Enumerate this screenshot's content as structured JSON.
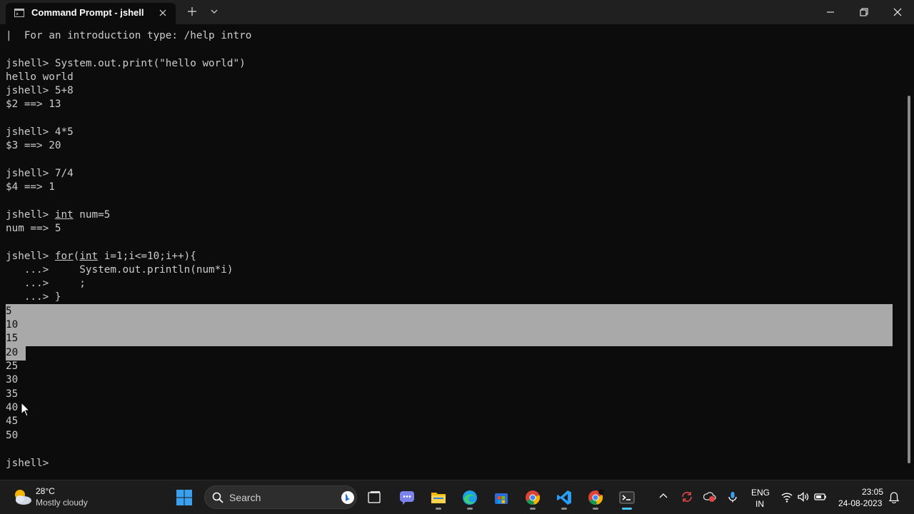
{
  "window": {
    "tab_title": "Command Prompt - jshell",
    "icons": {
      "tab": "terminal-icon",
      "close_tab": "close-icon",
      "new_tab": "plus-icon",
      "dropdown": "chevron-down-icon",
      "minimize": "minimize-icon",
      "maximize": "restore-icon",
      "close": "close-icon"
    }
  },
  "terminal": {
    "lines": [
      "|  For an introduction type: /help intro",
      "",
      "jshell> System.out.print(\"hello world\")",
      "hello world",
      "jshell> 5+8",
      "$2 ==> 13",
      "",
      "jshell> 4*5",
      "$3 ==> 20",
      "",
      "jshell> 7/4",
      "$4 ==> 1",
      "",
      "jshell> int num=5",
      "num ==> 5",
      "",
      "jshell> for(int i=1;i<=10;i++){",
      "   ...>     System.out.println(num*i)",
      "   ...>     ;",
      "   ...> }",
      "5",
      "10",
      "15",
      "20",
      "25",
      "30",
      "35",
      "40",
      "45",
      "50",
      "",
      "jshell>"
    ],
    "selected_lines": [
      "5",
      "10",
      "15",
      "20"
    ],
    "underlined_keywords": [
      "int",
      "for"
    ],
    "colors": {
      "background": "#0c0c0c",
      "foreground": "#cccccc",
      "selection": "#a9a9a9"
    }
  },
  "taskbar": {
    "weather": {
      "temperature": "28°C",
      "condition": "Mostly cloudy",
      "icon": "partly-cloudy-icon"
    },
    "search": {
      "placeholder": "Search"
    },
    "apps": [
      {
        "name": "windows-start",
        "icon": "windows-logo-icon"
      },
      {
        "name": "task-view",
        "icon": "task-view-icon"
      },
      {
        "name": "teams",
        "icon": "teams-chat-icon"
      },
      {
        "name": "file-explorer",
        "icon": "folder-icon",
        "running": true
      },
      {
        "name": "edge",
        "icon": "edge-icon",
        "running": true
      },
      {
        "name": "store",
        "icon": "store-icon"
      },
      {
        "name": "chrome",
        "icon": "chrome-icon",
        "running": true
      },
      {
        "name": "vscode",
        "icon": "vscode-icon",
        "running": true
      },
      {
        "name": "chrome-profile",
        "icon": "chrome-icon",
        "running": true
      },
      {
        "name": "terminal",
        "icon": "terminal-icon",
        "running": true,
        "active": true
      }
    ],
    "tray": {
      "language_line1": "ENG",
      "language_line2": "IN",
      "time": "23:05",
      "date": "24-08-2023"
    },
    "accent_color": "#4cc2ff"
  }
}
